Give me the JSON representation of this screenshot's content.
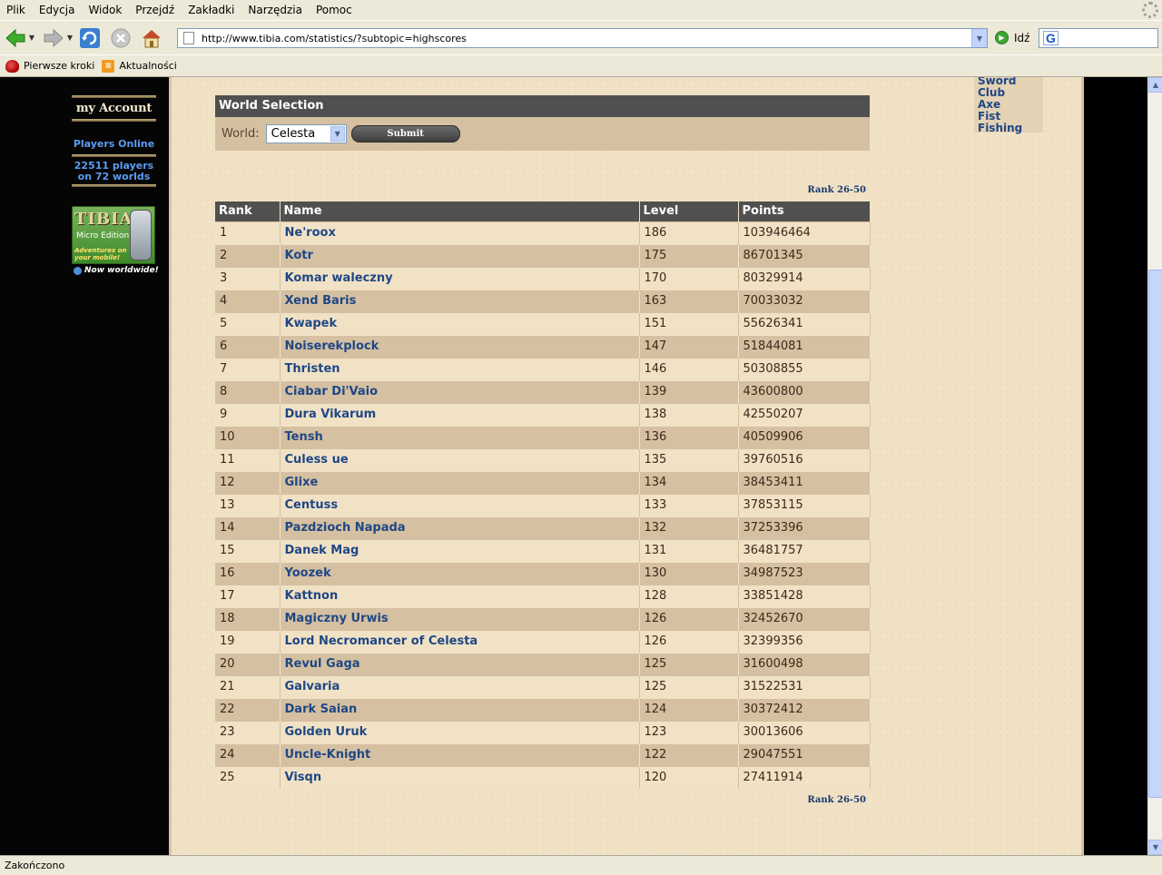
{
  "menubar": {
    "items": [
      "Plik",
      "Edycja",
      "Widok",
      "Przejdź",
      "Zakładki",
      "Narzędzia",
      "Pomoc"
    ]
  },
  "navbar": {
    "url": "http://www.tibia.com/statistics/?subtopic=highscores",
    "go_label": "Idź",
    "icons": [
      "back-icon",
      "forward-icon",
      "reload-icon",
      "stop-icon",
      "home-icon",
      "go-icon",
      "google-icon"
    ]
  },
  "bookmarks": {
    "items": [
      {
        "label": "Pierwsze kroki",
        "icon": "firefox-icon"
      },
      {
        "label": "Aktualności",
        "icon": "rss-icon"
      }
    ]
  },
  "sidebar": {
    "my_account": "my Account",
    "players_online": "Players Online",
    "players_count_line1": "22511 players",
    "players_count_line2": "on 72 worlds",
    "banner": {
      "logo": "TIBIA",
      "subtitle": "Micro Edition",
      "tagline": "Adventures on your mobile!",
      "footer": "Now worldwide!"
    }
  },
  "skills_box": {
    "items": [
      "Sword",
      "Club",
      "Axe",
      "Fist",
      "Fishing"
    ]
  },
  "world_selection": {
    "title": "World Selection",
    "label": "World:",
    "selected": "Celesta",
    "submit": "Submit"
  },
  "rank_link_top": "Rank 26-50",
  "rank_link_bottom": "Rank 26-50",
  "highscores": {
    "columns": [
      "Rank",
      "Name",
      "Level",
      "Points"
    ],
    "rows": [
      {
        "rank": "1",
        "name": "Ne'roox",
        "level": "186",
        "points": "103946464"
      },
      {
        "rank": "2",
        "name": "Kotr",
        "level": "175",
        "points": "86701345"
      },
      {
        "rank": "3",
        "name": "Komar waleczny",
        "level": "170",
        "points": "80329914"
      },
      {
        "rank": "4",
        "name": "Xend Baris",
        "level": "163",
        "points": "70033032"
      },
      {
        "rank": "5",
        "name": "Kwapek",
        "level": "151",
        "points": "55626341"
      },
      {
        "rank": "6",
        "name": "Noiserekplock",
        "level": "147",
        "points": "51844081"
      },
      {
        "rank": "7",
        "name": "Thristen",
        "level": "146",
        "points": "50308855"
      },
      {
        "rank": "8",
        "name": "Ciabar Di'Vaio",
        "level": "139",
        "points": "43600800"
      },
      {
        "rank": "9",
        "name": "Dura Vikarum",
        "level": "138",
        "points": "42550207"
      },
      {
        "rank": "10",
        "name": "Tensh",
        "level": "136",
        "points": "40509906"
      },
      {
        "rank": "11",
        "name": "Culess ue",
        "level": "135",
        "points": "39760516"
      },
      {
        "rank": "12",
        "name": "Glixe",
        "level": "134",
        "points": "38453411"
      },
      {
        "rank": "13",
        "name": "Centuss",
        "level": "133",
        "points": "37853115"
      },
      {
        "rank": "14",
        "name": "Pazdzioch Napada",
        "level": "132",
        "points": "37253396"
      },
      {
        "rank": "15",
        "name": "Danek Mag",
        "level": "131",
        "points": "36481757"
      },
      {
        "rank": "16",
        "name": "Yoozek",
        "level": "130",
        "points": "34987523"
      },
      {
        "rank": "17",
        "name": "Kattnon",
        "level": "128",
        "points": "33851428"
      },
      {
        "rank": "18",
        "name": "Magiczny Urwis",
        "level": "126",
        "points": "32452670"
      },
      {
        "rank": "19",
        "name": "Lord Necromancer of Celesta",
        "level": "126",
        "points": "32399356"
      },
      {
        "rank": "20",
        "name": "Revul Gaga",
        "level": "125",
        "points": "31600498"
      },
      {
        "rank": "21",
        "name": "Galvaria",
        "level": "125",
        "points": "31522531"
      },
      {
        "rank": "22",
        "name": "Dark Saian",
        "level": "124",
        "points": "30372412"
      },
      {
        "rank": "23",
        "name": "Golden Uruk",
        "level": "123",
        "points": "30013606"
      },
      {
        "rank": "24",
        "name": "Uncle-Knight",
        "level": "122",
        "points": "29047551"
      },
      {
        "rank": "25",
        "name": "Visqn",
        "level": "120",
        "points": "27411914"
      }
    ]
  },
  "statusbar": {
    "text": "Zakończono"
  },
  "colors": {
    "header_bg": "#505050",
    "row_light": "#f1e2c6",
    "row_dark": "#d5c0a1",
    "link": "#1f4785",
    "sidebar_text": "#5b9cf0"
  }
}
